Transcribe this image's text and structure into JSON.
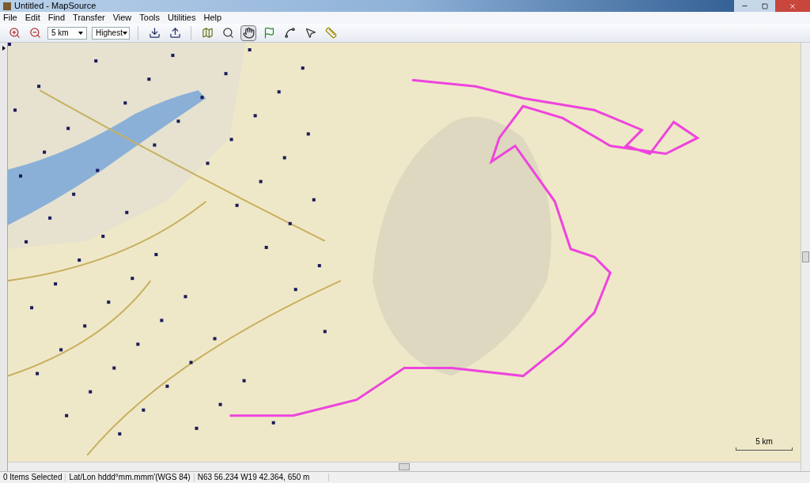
{
  "window": {
    "title": "Untitled - MapSource"
  },
  "menu": [
    "File",
    "Edit",
    "Find",
    "Transfer",
    "View",
    "Tools",
    "Utilities",
    "Help"
  ],
  "toolbar": {
    "zoom_select": "5 km",
    "detail_select": "Highest",
    "tools": [
      {
        "kind": "zoom-in",
        "selected": false
      },
      {
        "kind": "zoom-out",
        "selected": false
      },
      {
        "kind": "receive",
        "selected": false
      },
      {
        "kind": "send",
        "selected": false
      },
      {
        "kind": "map",
        "selected": false
      },
      {
        "kind": "zoom-tool",
        "selected": false
      },
      {
        "kind": "hand",
        "selected": true
      },
      {
        "kind": "flag",
        "selected": false
      },
      {
        "kind": "route",
        "selected": false
      },
      {
        "kind": "pointer",
        "selected": false
      },
      {
        "kind": "ruler",
        "selected": false
      }
    ]
  },
  "map": {
    "scale_label": "5 km"
  },
  "status_bar": [
    "0 Items Selected",
    "Lat/Lon hddd°mm.mmm'(WGS 84)",
    "N63 56.234 W19 42.364, 650 m"
  ]
}
